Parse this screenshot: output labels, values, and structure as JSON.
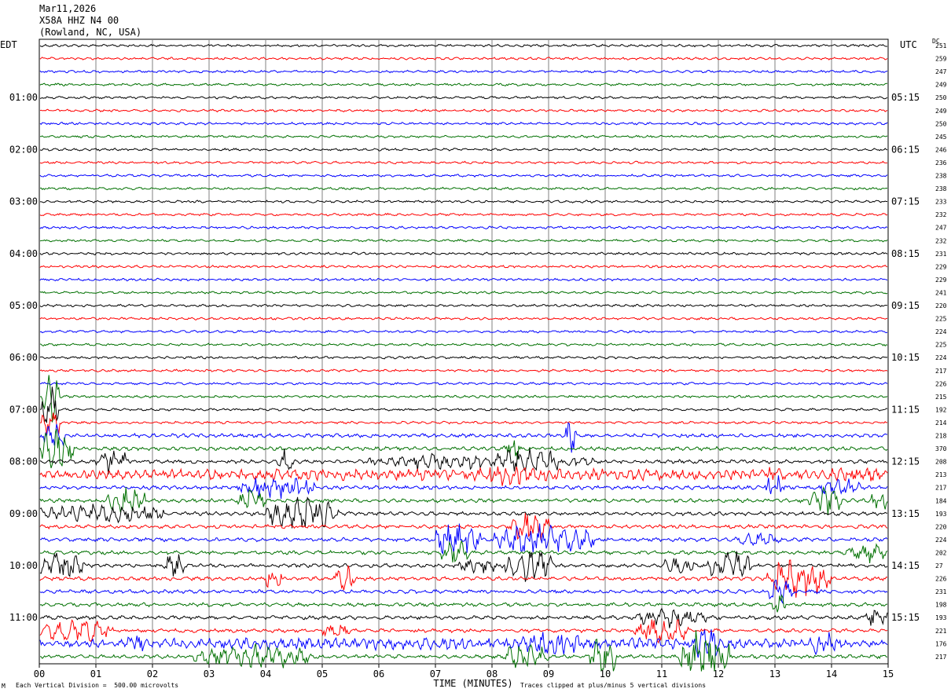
{
  "header": {
    "date": "Mar11,2026",
    "station": "X58A HHZ N4 00",
    "location": "(Rowland, NC, USA)"
  },
  "left_axis_label": "EDT",
  "right_axis_label": "UTC",
  "dc_label": "DC",
  "footer": {
    "scale_note": "Each Vertical Division =  500.00 microvolts",
    "clip_note": "Traces clipped at plus/minus 5 vertical divisions",
    "corner_mark": "M"
  },
  "colors": {
    "trace_cycle": [
      "#000000",
      "#ff0000",
      "#0000ff",
      "#007000"
    ],
    "grid": "#808080"
  },
  "chart_data": {
    "type": "line",
    "title": "X58A HHZ N4 00 (Rowland, NC, USA)",
    "xlabel": "TIME (MINUTES)",
    "xlim": [
      0,
      15
    ],
    "x_ticks": [
      "00",
      "01",
      "02",
      "03",
      "04",
      "05",
      "06",
      "07",
      "08",
      "09",
      "10",
      "11",
      "12",
      "13",
      "14",
      "15"
    ],
    "left_time_labels": [
      "01:00",
      "02:00",
      "03:00",
      "04:00",
      "05:00",
      "06:00",
      "07:00",
      "08:00",
      "09:00",
      "10:00",
      "11:00"
    ],
    "right_time_labels": [
      "05:15",
      "06:15",
      "07:15",
      "08:15",
      "09:15",
      "10:15",
      "11:15",
      "12:15",
      "13:15",
      "14:15",
      "15:15"
    ],
    "dc_offsets": [
      251,
      259,
      247,
      249,
      250,
      249,
      250,
      245,
      246,
      236,
      238,
      238,
      233,
      232,
      247,
      232,
      231,
      229,
      229,
      241,
      220,
      225,
      224,
      225,
      224,
      217,
      226,
      215,
      192,
      214,
      218,
      370,
      208,
      213,
      217,
      184,
      193,
      220,
      224,
      202,
      27,
      226,
      231,
      198,
      193,
      221,
      176,
      217
    ],
    "trace_count": 48,
    "trace_minutes_per_line": 15,
    "events": [
      {
        "trace": 27,
        "start": 0.05,
        "end": 0.35,
        "amp": 4.5
      },
      {
        "trace": 28,
        "start": 0.05,
        "end": 0.35,
        "amp": 4
      },
      {
        "trace": 29,
        "start": 0.05,
        "end": 0.4,
        "amp": 3
      },
      {
        "trace": 30,
        "start": 0.0,
        "end": 0.5,
        "amp": 2
      },
      {
        "trace": 31,
        "start": 0.0,
        "end": 0.6,
        "amp": 3.5
      },
      {
        "trace": 32,
        "start": 1.0,
        "end": 1.6,
        "amp": 2
      },
      {
        "trace": 32,
        "start": 5.8,
        "end": 9.8,
        "amp": 1
      },
      {
        "trace": 32,
        "start": 6.6,
        "end": 7.2,
        "amp": 1.8
      },
      {
        "trace": 32,
        "start": 8.0,
        "end": 9.3,
        "amp": 2
      },
      {
        "trace": 31,
        "start": 8.2,
        "end": 8.5,
        "amp": 2.5
      },
      {
        "trace": 30,
        "start": 9.3,
        "end": 9.5,
        "amp": 3
      },
      {
        "trace": 32,
        "start": 4.2,
        "end": 4.5,
        "amp": 2.5
      },
      {
        "trace": 33,
        "start": 0.0,
        "end": 15.0,
        "amp": 0.8
      },
      {
        "trace": 33,
        "start": 7.7,
        "end": 8.8,
        "amp": 1.8
      },
      {
        "trace": 33,
        "start": 12.8,
        "end": 13.2,
        "amp": 1.5
      },
      {
        "trace": 34,
        "start": 3.5,
        "end": 4.9,
        "amp": 1.8
      },
      {
        "trace": 34,
        "start": 12.8,
        "end": 13.2,
        "amp": 2
      },
      {
        "trace": 35,
        "start": 1.2,
        "end": 1.9,
        "amp": 2
      },
      {
        "trace": 35,
        "start": 3.5,
        "end": 4.0,
        "amp": 2
      },
      {
        "trace": 35,
        "start": 13.6,
        "end": 14.2,
        "amp": 2.5
      },
      {
        "trace": 34,
        "start": 13.8,
        "end": 14.5,
        "amp": 1.5
      },
      {
        "trace": 33,
        "start": 13.8,
        "end": 14.9,
        "amp": 1.2
      },
      {
        "trace": 35,
        "start": 14.7,
        "end": 15.0,
        "amp": 2
      },
      {
        "trace": 36,
        "start": 0.0,
        "end": 2.2,
        "amp": 1.5
      },
      {
        "trace": 36,
        "start": 4.0,
        "end": 5.3,
        "amp": 3
      },
      {
        "trace": 37,
        "start": 8.3,
        "end": 9.0,
        "amp": 3
      },
      {
        "trace": 38,
        "start": 7.0,
        "end": 7.8,
        "amp": 3
      },
      {
        "trace": 38,
        "start": 8.0,
        "end": 9.8,
        "amp": 2.5
      },
      {
        "trace": 39,
        "start": 7.1,
        "end": 7.6,
        "amp": 2
      },
      {
        "trace": 39,
        "start": 14.2,
        "end": 15.0,
        "amp": 1.5
      },
      {
        "trace": 38,
        "start": 12.3,
        "end": 13.1,
        "amp": 1
      },
      {
        "trace": 40,
        "start": 0.0,
        "end": 0.8,
        "amp": 2.5
      },
      {
        "trace": 40,
        "start": 2.2,
        "end": 2.6,
        "amp": 2
      },
      {
        "trace": 40,
        "start": 7.4,
        "end": 8.2,
        "amp": 1
      },
      {
        "trace": 40,
        "start": 8.2,
        "end": 9.1,
        "amp": 2.5
      },
      {
        "trace": 40,
        "start": 11.0,
        "end": 11.6,
        "amp": 1.2
      },
      {
        "trace": 40,
        "start": 11.8,
        "end": 12.6,
        "amp": 2.5
      },
      {
        "trace": 41,
        "start": 4.0,
        "end": 4.3,
        "amp": 2
      },
      {
        "trace": 41,
        "start": 5.2,
        "end": 5.6,
        "amp": 2
      },
      {
        "trace": 41,
        "start": 12.8,
        "end": 14.0,
        "amp": 3.5
      },
      {
        "trace": 42,
        "start": 12.9,
        "end": 13.3,
        "amp": 2
      },
      {
        "trace": 43,
        "start": 12.9,
        "end": 13.2,
        "amp": 1.5
      },
      {
        "trace": 44,
        "start": 10.5,
        "end": 11.8,
        "amp": 1.5
      },
      {
        "trace": 44,
        "start": 14.6,
        "end": 15.0,
        "amp": 1.5
      },
      {
        "trace": 45,
        "start": 0.0,
        "end": 1.3,
        "amp": 1.8
      },
      {
        "trace": 45,
        "start": 10.5,
        "end": 11.5,
        "amp": 2
      },
      {
        "trace": 45,
        "start": 5.0,
        "end": 5.5,
        "amp": 1
      },
      {
        "trace": 46,
        "start": 0.0,
        "end": 15.0,
        "amp": 0.8
      },
      {
        "trace": 46,
        "start": 1.5,
        "end": 2.0,
        "amp": 1.5
      },
      {
        "trace": 46,
        "start": 8.5,
        "end": 9.6,
        "amp": 2
      },
      {
        "trace": 46,
        "start": 13.6,
        "end": 14.2,
        "amp": 2
      },
      {
        "trace": 47,
        "start": 2.7,
        "end": 4.8,
        "amp": 2
      },
      {
        "trace": 47,
        "start": 8.2,
        "end": 9.0,
        "amp": 2
      },
      {
        "trace": 47,
        "start": 9.7,
        "end": 10.2,
        "amp": 4
      },
      {
        "trace": 47,
        "start": 11.3,
        "end": 12.2,
        "amp": 4.5
      },
      {
        "trace": 46,
        "start": 11.6,
        "end": 12.0,
        "amp": 3.5
      }
    ]
  }
}
